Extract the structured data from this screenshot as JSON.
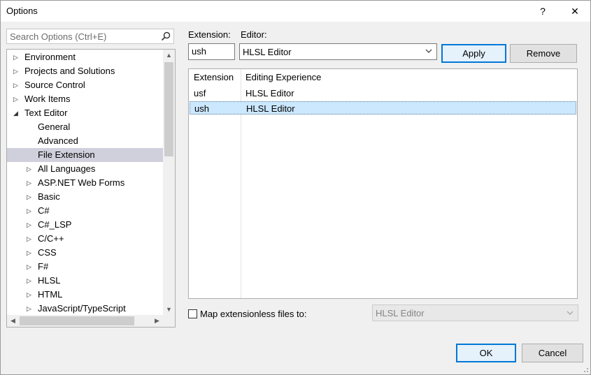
{
  "window": {
    "title": "Options",
    "help_glyph": "?",
    "close_glyph": "✕"
  },
  "search": {
    "placeholder": "Search Options (Ctrl+E)"
  },
  "tree": {
    "items": [
      {
        "label": "Environment",
        "level": 0,
        "expanded": false
      },
      {
        "label": "Projects and Solutions",
        "level": 0,
        "expanded": false
      },
      {
        "label": "Source Control",
        "level": 0,
        "expanded": false
      },
      {
        "label": "Work Items",
        "level": 0,
        "expanded": false
      },
      {
        "label": "Text Editor",
        "level": 0,
        "expanded": true
      },
      {
        "label": "General",
        "level": 1,
        "leaf": true
      },
      {
        "label": "Advanced",
        "level": 1,
        "leaf": true
      },
      {
        "label": "File Extension",
        "level": 1,
        "leaf": true,
        "selected": true
      },
      {
        "label": "All Languages",
        "level": 1,
        "expanded": false
      },
      {
        "label": "ASP.NET Web Forms",
        "level": 1,
        "expanded": false
      },
      {
        "label": "Basic",
        "level": 1,
        "expanded": false
      },
      {
        "label": "C#",
        "level": 1,
        "expanded": false
      },
      {
        "label": "C#_LSP",
        "level": 1,
        "expanded": false
      },
      {
        "label": "C/C++",
        "level": 1,
        "expanded": false
      },
      {
        "label": "CSS",
        "level": 1,
        "expanded": false
      },
      {
        "label": "F#",
        "level": 1,
        "expanded": false
      },
      {
        "label": "HLSL",
        "level": 1,
        "expanded": false
      },
      {
        "label": "HTML",
        "level": 1,
        "expanded": false
      },
      {
        "label": "JavaScript/TypeScript",
        "level": 1,
        "expanded": false
      }
    ]
  },
  "form": {
    "extension_label": "Extension:",
    "extension_value": "ush",
    "editor_label": "Editor:",
    "editor_value": "HLSL Editor",
    "apply_label": "Apply",
    "remove_label": "Remove"
  },
  "list": {
    "columns": [
      "Extension",
      "Editing Experience"
    ],
    "rows": [
      {
        "extension": "usf",
        "experience": "HLSL Editor",
        "selected": false
      },
      {
        "extension": "ush",
        "experience": "HLSL Editor",
        "selected": true
      }
    ]
  },
  "extensionless": {
    "label": "Map extensionless files to:",
    "checked": false,
    "value": "HLSL Editor"
  },
  "footer": {
    "ok_label": "OK",
    "cancel_label": "Cancel"
  },
  "colors": {
    "accent": "#0078d7",
    "tree_selection": "#cfd0dc",
    "list_selection": "#cce8ff"
  }
}
